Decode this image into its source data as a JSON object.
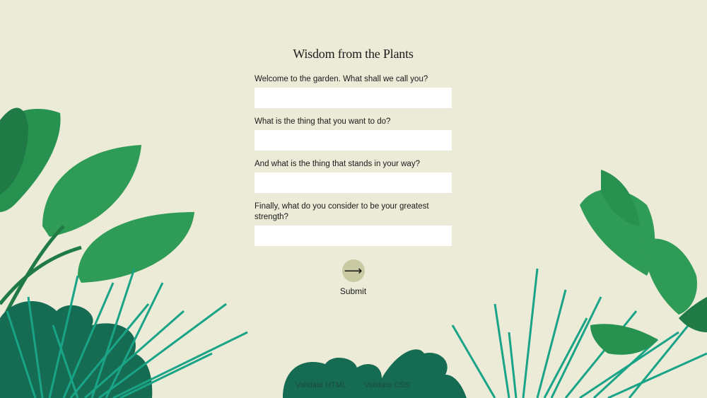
{
  "title": "Wisdom from the Plants",
  "questions": [
    {
      "label": "Welcome to the garden. What shall we call you?",
      "value": ""
    },
    {
      "label": "What is the thing that you want to do?",
      "value": ""
    },
    {
      "label": "And what is the thing that stands in your way?",
      "value": ""
    },
    {
      "label": "Finally, what do you consider to be your greatest strength?",
      "value": ""
    }
  ],
  "submit": {
    "icon": "arrow-right-icon",
    "glyph": "⟶",
    "label": "Submit"
  },
  "footer": {
    "validate_html": "Validate HTML",
    "validate_css": "Validate CSS"
  },
  "colors": {
    "background": "#ebebd8",
    "leaf_dark": "#1f7a45",
    "leaf_mid": "#2e9b56",
    "grass": "#19a387",
    "bush": "#156c52",
    "button": "#c9c9a3"
  }
}
